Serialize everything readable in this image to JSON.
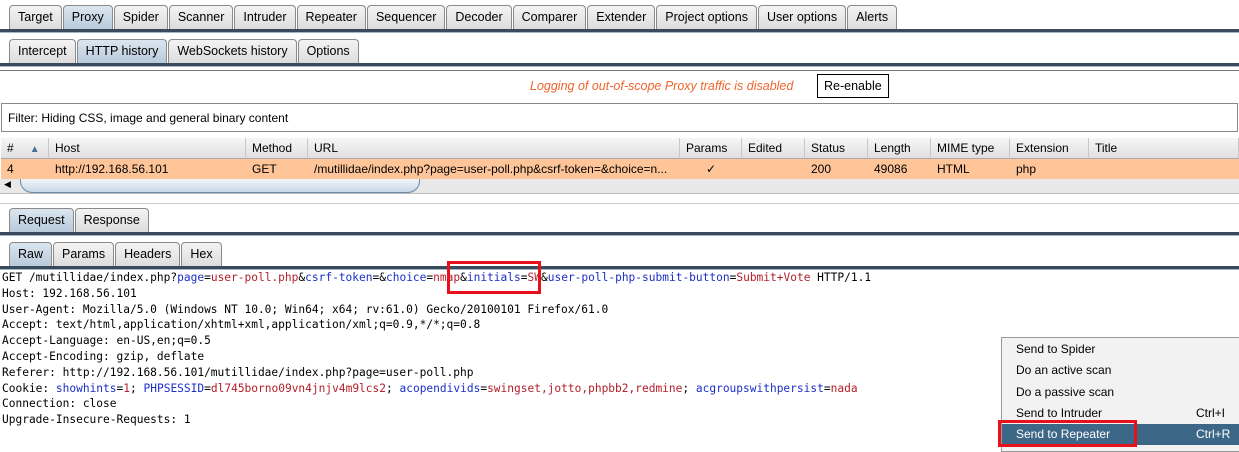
{
  "top_tabs": [
    "Target",
    "Proxy",
    "Spider",
    "Scanner",
    "Intruder",
    "Repeater",
    "Sequencer",
    "Decoder",
    "Comparer",
    "Extender",
    "Project options",
    "User options",
    "Alerts"
  ],
  "top_selected": "Proxy",
  "sub_tabs": [
    "Intercept",
    "HTTP history",
    "WebSockets history",
    "Options"
  ],
  "sub_selected": "HTTP history",
  "log_message": "Logging of out-of-scope Proxy traffic is disabled",
  "reenable_label": "Re-enable",
  "filter": "Filter: Hiding CSS, image and general binary content",
  "table": {
    "columns": [
      "#",
      "Host",
      "Method",
      "URL",
      "Params",
      "Edited",
      "Status",
      "Length",
      "MIME type",
      "Extension",
      "Title"
    ],
    "sort_indicator": "▲",
    "rows": [
      [
        "4",
        "http://192.168.56.101",
        "GET",
        "/mutillidae/index.php?page=user-poll.php&csrf-token=&choice=n...",
        "✓",
        "",
        "200",
        "49086",
        "HTML",
        "php",
        ""
      ]
    ],
    "row_highlight": "#ffc598"
  },
  "msg_tabs": [
    "Request",
    "Response"
  ],
  "msg_selected": "Request",
  "view_tabs": [
    "Raw",
    "Params",
    "Headers",
    "Hex"
  ],
  "view_selected": "Raw",
  "request_lines": [
    [
      [
        "k",
        "GET /mutillidae/index.php?"
      ],
      [
        "b",
        "page"
      ],
      [
        "k",
        "="
      ],
      [
        "r",
        "user-poll.php"
      ],
      [
        "k",
        "&"
      ],
      [
        "b",
        "csrf-token"
      ],
      [
        "k",
        "=&"
      ],
      [
        "b",
        "choice"
      ],
      [
        "k",
        "="
      ],
      [
        "r",
        "nmap"
      ],
      [
        "k",
        "&"
      ],
      [
        "b",
        "initials"
      ],
      [
        "k",
        "="
      ],
      [
        "r",
        "SW"
      ],
      [
        "k",
        "&"
      ],
      [
        "b",
        "user-poll-php-submit-button"
      ],
      [
        "k",
        "="
      ],
      [
        "r",
        "Submit+Vote"
      ],
      [
        "k",
        " HTTP/1.1"
      ]
    ],
    [
      [
        "k",
        "Host: 192.168.56.101"
      ]
    ],
    [
      [
        "k",
        "User-Agent: Mozilla/5.0 (Windows NT 10.0; Win64; x64; rv:61.0) Gecko/20100101 Firefox/61.0"
      ]
    ],
    [
      [
        "k",
        "Accept: text/html,application/xhtml+xml,application/xml;q=0.9,*/*;q=0.8"
      ]
    ],
    [
      [
        "k",
        "Accept-Language: en-US,en;q=0.5"
      ]
    ],
    [
      [
        "k",
        "Accept-Encoding: gzip, deflate"
      ]
    ],
    [
      [
        "k",
        "Referer: http://192.168.56.101/mutillidae/index.php?page=user-poll.php"
      ]
    ],
    [
      [
        "k",
        "Cookie: "
      ],
      [
        "b",
        "showhints"
      ],
      [
        "k",
        "="
      ],
      [
        "r",
        "1"
      ],
      [
        "k",
        "; "
      ],
      [
        "b",
        "PHPSESSID"
      ],
      [
        "k",
        "="
      ],
      [
        "r",
        "dl745borno09vn4jnjv4m9lcs2"
      ],
      [
        "k",
        "; "
      ],
      [
        "b",
        "acopendivids"
      ],
      [
        "k",
        "="
      ],
      [
        "r",
        "swingset,jotto,phpbb2,redmine"
      ],
      [
        "k",
        "; "
      ],
      [
        "b",
        "acgroupswithpersist"
      ],
      [
        "k",
        "="
      ],
      [
        "r",
        "nada"
      ]
    ],
    [
      [
        "k",
        "Connection: close"
      ]
    ],
    [
      [
        "k",
        "Upgrade-Insecure-Requests: 1"
      ]
    ]
  ],
  "context_menu": [
    {
      "label": "Send to Spider",
      "shortcut": ""
    },
    {
      "label": "Do an active scan",
      "shortcut": ""
    },
    {
      "label": "Do a passive scan",
      "shortcut": ""
    },
    {
      "label": "Send to Intruder",
      "shortcut": "Ctrl+I"
    },
    {
      "label": "Send to Repeater",
      "shortcut": "Ctrl+R",
      "highlighted": true
    }
  ],
  "colors": {
    "menu_highlight": "#3d6787",
    "annotation": "#e8101a",
    "log_message": "#f0642c"
  }
}
